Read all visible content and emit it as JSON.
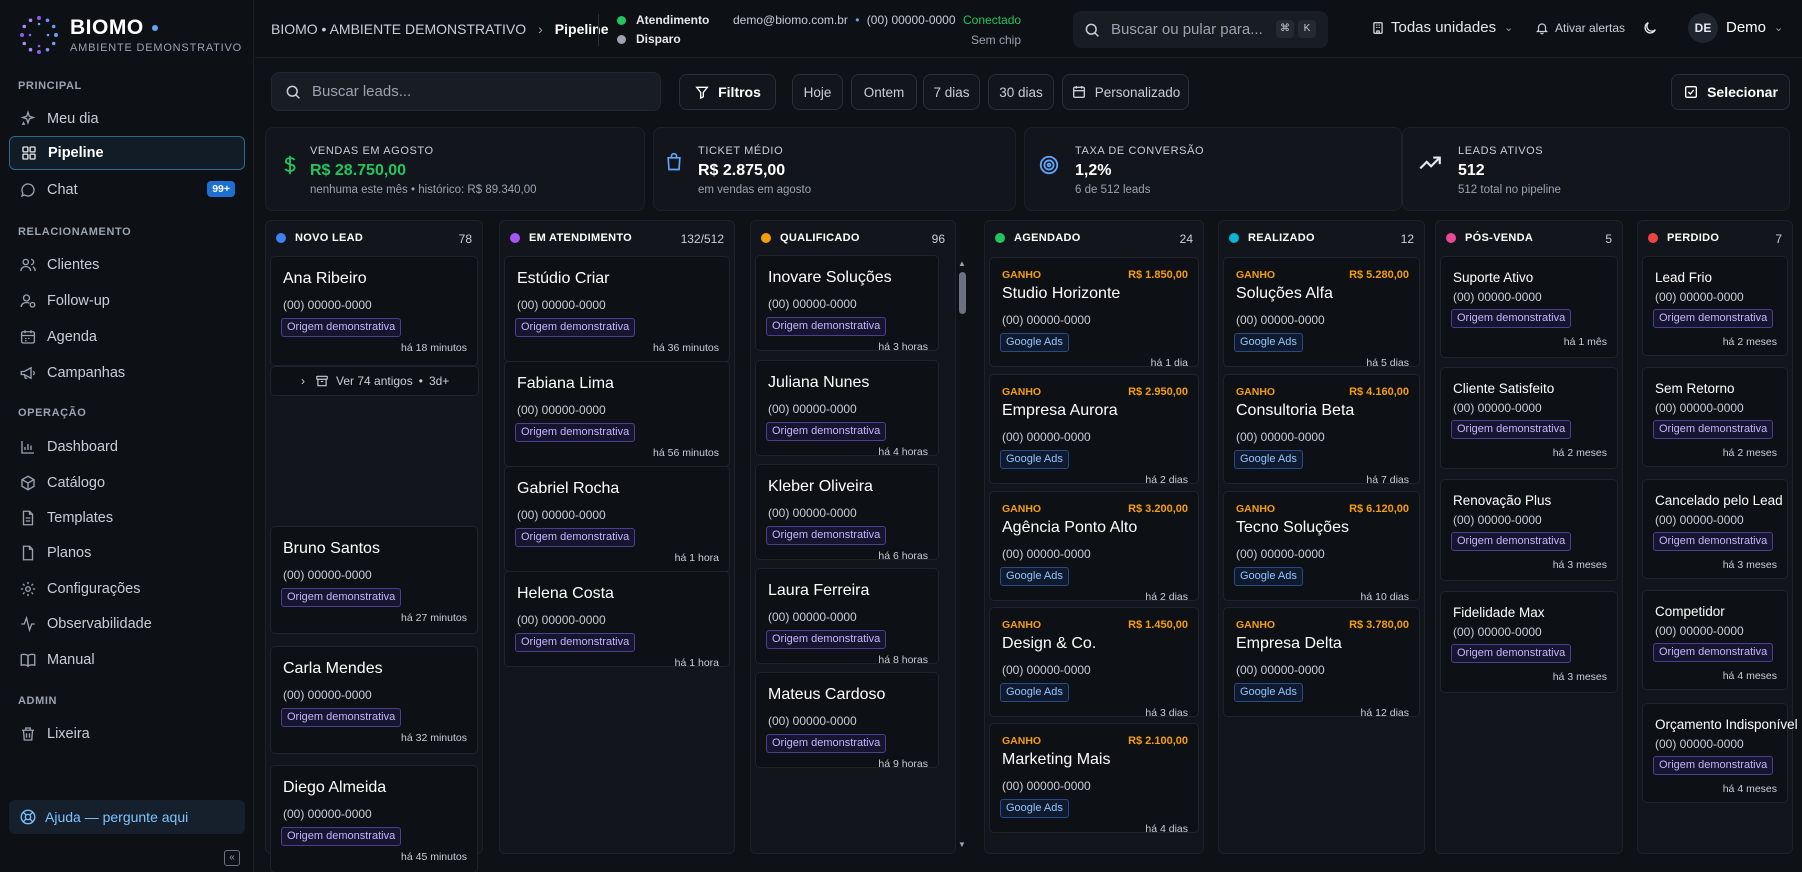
{
  "brand": {
    "name": "BIOMO",
    "subtitle": "AMBIENTE DEMONSTRATIVO"
  },
  "sidebar": {
    "sections": [
      "PRINCIPAL",
      "RELACIONAMENTO",
      "OPERAÇÃO",
      "ADMIN"
    ],
    "items": [
      {
        "label": "Meu dia",
        "icon": "sparkle-icon"
      },
      {
        "label": "Pipeline",
        "icon": "grid-icon",
        "active": true
      },
      {
        "label": "Chat",
        "icon": "chat-icon",
        "badge": "99+"
      },
      {
        "label": "Clientes",
        "icon": "users-icon"
      },
      {
        "label": "Follow-up",
        "icon": "user-follow-icon"
      },
      {
        "label": "Agenda",
        "icon": "calendar-icon"
      },
      {
        "label": "Campanhas",
        "icon": "megaphone-icon"
      },
      {
        "label": "Dashboard",
        "icon": "chart-bar-icon"
      },
      {
        "label": "Catálogo",
        "icon": "box-icon"
      },
      {
        "label": "Templates",
        "icon": "document-icon"
      },
      {
        "label": "Planos",
        "icon": "file-icon"
      },
      {
        "label": "Configurações",
        "icon": "gear-icon"
      },
      {
        "label": "Observabilidade",
        "icon": "activity-icon"
      },
      {
        "label": "Manual",
        "icon": "book-icon"
      },
      {
        "label": "Lixeira",
        "icon": "trash-icon"
      }
    ],
    "help": "Ajuda — pergunte aqui"
  },
  "header": {
    "breadcrumb_root": "BIOMO • AMBIENTE DEMONSTRATIVO",
    "breadcrumb_current": "Pipeline",
    "channels": [
      {
        "label": "Atendimento",
        "color": "#22c55e"
      },
      {
        "label": "Disparo",
        "color": "#9ca3af"
      }
    ],
    "account": "demo@biomo.com.br",
    "account_sep": "•",
    "account_phone": "(00) 00000-0000",
    "status": "Conectado",
    "chip": "Sem chip",
    "search_placeholder": "Buscar ou pular para...",
    "kbd1": "⌘",
    "kbd2": "K",
    "units": "Todas unidades",
    "alerts": "Ativar alertas",
    "avatar": "DE",
    "user": "Demo"
  },
  "toolbar": {
    "search_placeholder": "Buscar leads...",
    "filters": "Filtros",
    "periods": [
      "Hoje",
      "Ontem",
      "7 dias",
      "30 dias"
    ],
    "custom": "Personalizado",
    "select": "Selecionar"
  },
  "stats": [
    {
      "label": "VENDAS EM AGOSTO",
      "value": "R$ 28.750,00",
      "sub": "nenhuma este mês • histórico: R$ 89.340,00",
      "color": "#22c55e"
    },
    {
      "label": "TICKET MÉDIO",
      "value": "R$ 2.875,00",
      "sub": "em vendas em agosto",
      "color": "#60a5fa"
    },
    {
      "label": "TAXA DE CONVERSÃO",
      "value": "1,2%",
      "sub": "6 de 512 leads",
      "color": "#60a5fa"
    },
    {
      "label": "LEADS ATIVOS",
      "value": "512",
      "sub": "512 total no pipeline",
      "color": "#e6e8ec"
    }
  ],
  "columns": [
    {
      "title": "NOVO LEAD",
      "count": "78",
      "color": "#3b82f6",
      "cards": [
        {
          "name": "Ana Ribeiro",
          "phone": "(00) 00000-0000",
          "tag": "Origem demonstrativa",
          "time": "há 18 minutos"
        },
        {
          "name": "Bruno Santos",
          "phone": "(00) 00000-0000",
          "tag": "Origem demonstrativa",
          "time": "há 27 minutos"
        },
        {
          "name": "Carla Mendes",
          "phone": "(00) 00000-0000",
          "tag": "Origem demonstrativa",
          "time": "há 32 minutos"
        },
        {
          "name": "Diego Almeida",
          "phone": "(00) 00000-0000",
          "tag": "Origem demonstrativa",
          "time": "há 45 minutos"
        }
      ],
      "older": "Ver 74 antigos",
      "older_age": "3d+"
    },
    {
      "title": "EM ATENDIMENTO",
      "count": "132/512",
      "color": "#a855f7",
      "cards": [
        {
          "name": "Estúdio Criar",
          "phone": "(00) 00000-0000",
          "tag": "Origem demonstrativa",
          "time": "há 36 minutos"
        },
        {
          "name": "Fabiana Lima",
          "phone": "(00) 00000-0000",
          "tag": "Origem demonstrativa",
          "time": "há 56 minutos"
        },
        {
          "name": "Gabriel Rocha",
          "phone": "(00) 00000-0000",
          "tag": "Origem demonstrativa",
          "time": "há 1 hora"
        },
        {
          "name": "Helena Costa",
          "phone": "(00) 00000-0000",
          "tag": "Origem demonstrativa",
          "time": "há 1 hora"
        }
      ]
    },
    {
      "title": "QUALIFICADO",
      "count": "96",
      "color": "#f59e0b",
      "cards": [
        {
          "name": "Inovare Soluções",
          "phone": "(00) 00000-0000",
          "tag": "Origem demonstrativa",
          "time": "há 3 horas"
        },
        {
          "name": "Juliana Nunes",
          "phone": "(00) 00000-0000",
          "tag": "Origem demonstrativa",
          "time": "há 4 horas"
        },
        {
          "name": "Kleber Oliveira",
          "phone": "(00) 00000-0000",
          "tag": "Origem demonstrativa",
          "time": "há 6 horas"
        },
        {
          "name": "Laura Ferreira",
          "phone": "(00) 00000-0000",
          "tag": "Origem demonstrativa",
          "time": "há 8 horas"
        },
        {
          "name": "Mateus Cardoso",
          "phone": "(00) 00000-0000",
          "tag": "Origem demonstrativa",
          "time": "há 9 horas"
        }
      ]
    },
    {
      "title": "AGENDADO",
      "count": "24",
      "color": "#22c55e",
      "cards": [
        {
          "won": "GANHO",
          "amount": "R$ 1.850,00",
          "name": "Studio Horizonte",
          "phone": "(00) 00000-0000",
          "tag": "Google Ads",
          "time": "há 1 dia"
        },
        {
          "won": "GANHO",
          "amount": "R$ 2.950,00",
          "name": "Empresa Aurora",
          "phone": "(00) 00000-0000",
          "tag": "Google Ads",
          "time": "há 2 dias"
        },
        {
          "won": "GANHO",
          "amount": "R$ 3.200,00",
          "name": "Agência Ponto Alto",
          "phone": "(00) 00000-0000",
          "tag": "Google Ads",
          "time": "há 2 dias"
        },
        {
          "won": "GANHO",
          "amount": "R$ 1.450,00",
          "name": "Design & Co.",
          "phone": "(00) 00000-0000",
          "tag": "Google Ads",
          "time": "há 3 dias"
        },
        {
          "won": "GANHO",
          "amount": "R$ 2.100,00",
          "name": "Marketing Mais",
          "phone": "(00) 00000-0000",
          "tag": "Google Ads",
          "time": "há 4 dias"
        }
      ]
    },
    {
      "title": "REALIZADO",
      "count": "12",
      "color": "#06b6d4",
      "cards": [
        {
          "won": "GANHO",
          "amount": "R$ 5.280,00",
          "name": "Soluções Alfa",
          "phone": "(00) 00000-0000",
          "tag": "Google Ads",
          "time": "há 5 dias"
        },
        {
          "won": "GANHO",
          "amount": "R$ 4.160,00",
          "name": "Consultoria Beta",
          "phone": "(00) 00000-0000",
          "tag": "Google Ads",
          "time": "há 7 dias"
        },
        {
          "won": "GANHO",
          "amount": "R$ 6.120,00",
          "name": "Tecno Soluções",
          "phone": "(00) 00000-0000",
          "tag": "Google Ads",
          "time": "há 10 dias"
        },
        {
          "won": "GANHO",
          "amount": "R$ 3.780,00",
          "name": "Empresa Delta",
          "phone": "(00) 00000-0000",
          "tag": "Google Ads",
          "time": "há 12 dias"
        }
      ]
    },
    {
      "title": "PÓS-VENDA",
      "count": "5",
      "color": "#ec4899",
      "cards": [
        {
          "name": "Suporte Ativo",
          "phone": "(00) 00000-0000",
          "tag": "Origem demonstrativa",
          "time": "há 1 mês"
        },
        {
          "name": "Cliente Satisfeito",
          "phone": "(00) 00000-0000",
          "tag": "Origem demonstrativa",
          "time": "há 2 meses"
        },
        {
          "name": "Renovação Plus",
          "phone": "(00) 00000-0000",
          "tag": "Origem demonstrativa",
          "time": "há 3 meses"
        },
        {
          "name": "Fidelidade Max",
          "phone": "(00) 00000-0000",
          "tag": "Origem demonstrativa",
          "time": "há 3 meses"
        }
      ]
    },
    {
      "title": "PERDIDO",
      "count": "7",
      "color": "#ef4444",
      "cards": [
        {
          "name": "Lead Frio",
          "phone": "(00) 00000-0000",
          "tag": "Origem demonstrativa",
          "time": "há 2 meses"
        },
        {
          "name": "Sem Retorno",
          "phone": "(00) 00000-0000",
          "tag": "Origem demonstrativa",
          "time": "há 2 meses"
        },
        {
          "name": "Cancelado pelo Lead",
          "phone": "(00) 00000-0000",
          "tag": "Origem demonstrativa",
          "time": "há 3 meses"
        },
        {
          "name": "Competidor",
          "phone": "(00) 00000-0000",
          "tag": "Origem demonstrativa",
          "time": "há 4 meses"
        },
        {
          "name": "Orçamento Indisponível",
          "phone": "(00) 00000-0000",
          "tag": "Origem demonstrativa",
          "time": "há 4 meses"
        }
      ]
    }
  ]
}
